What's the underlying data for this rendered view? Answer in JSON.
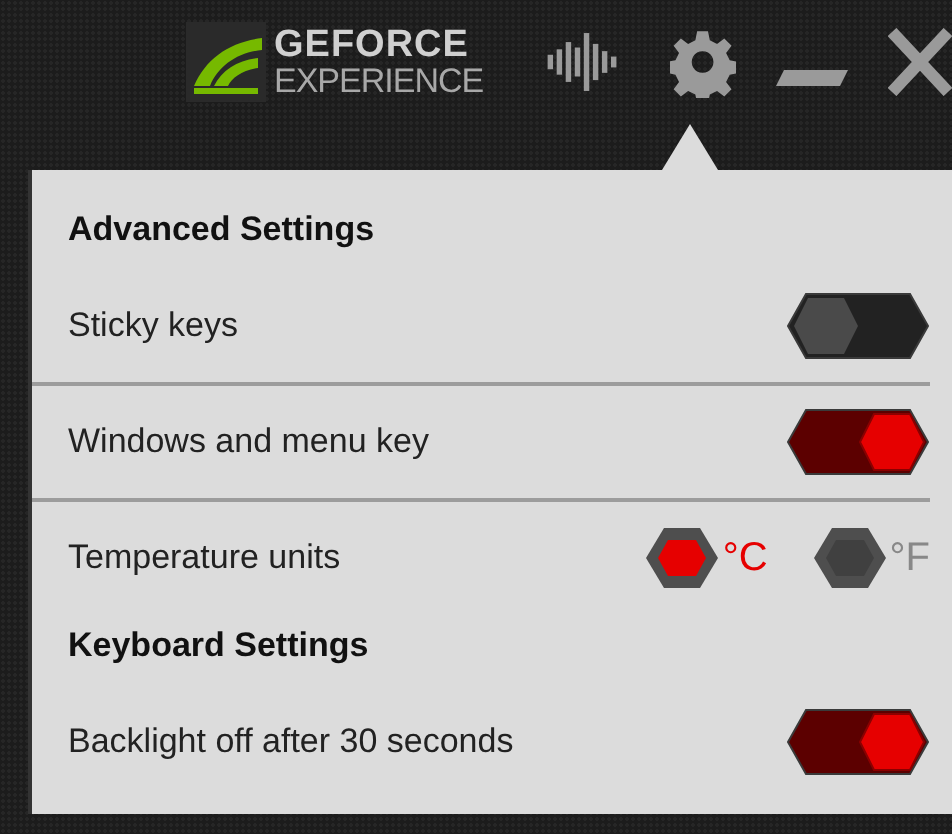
{
  "header": {
    "logo_line_1": "GEFORCE",
    "logo_line_2": "EXPERIENCE"
  },
  "sections": [
    {
      "title": "Advanced Settings",
      "rows": [
        {
          "kind": "toggle",
          "label": "Sticky keys",
          "on": false
        },
        {
          "kind": "toggle",
          "label": "Windows and menu key",
          "on": true
        },
        {
          "kind": "units",
          "label": "Temperature units",
          "options": [
            {
              "label": "°C",
              "selected": true
            },
            {
              "label": "°F",
              "selected": false
            }
          ]
        }
      ]
    },
    {
      "title": "Keyboard Settings",
      "rows": [
        {
          "kind": "toggle",
          "label": "Backlight off after 30 seconds",
          "on": true
        }
      ]
    }
  ]
}
